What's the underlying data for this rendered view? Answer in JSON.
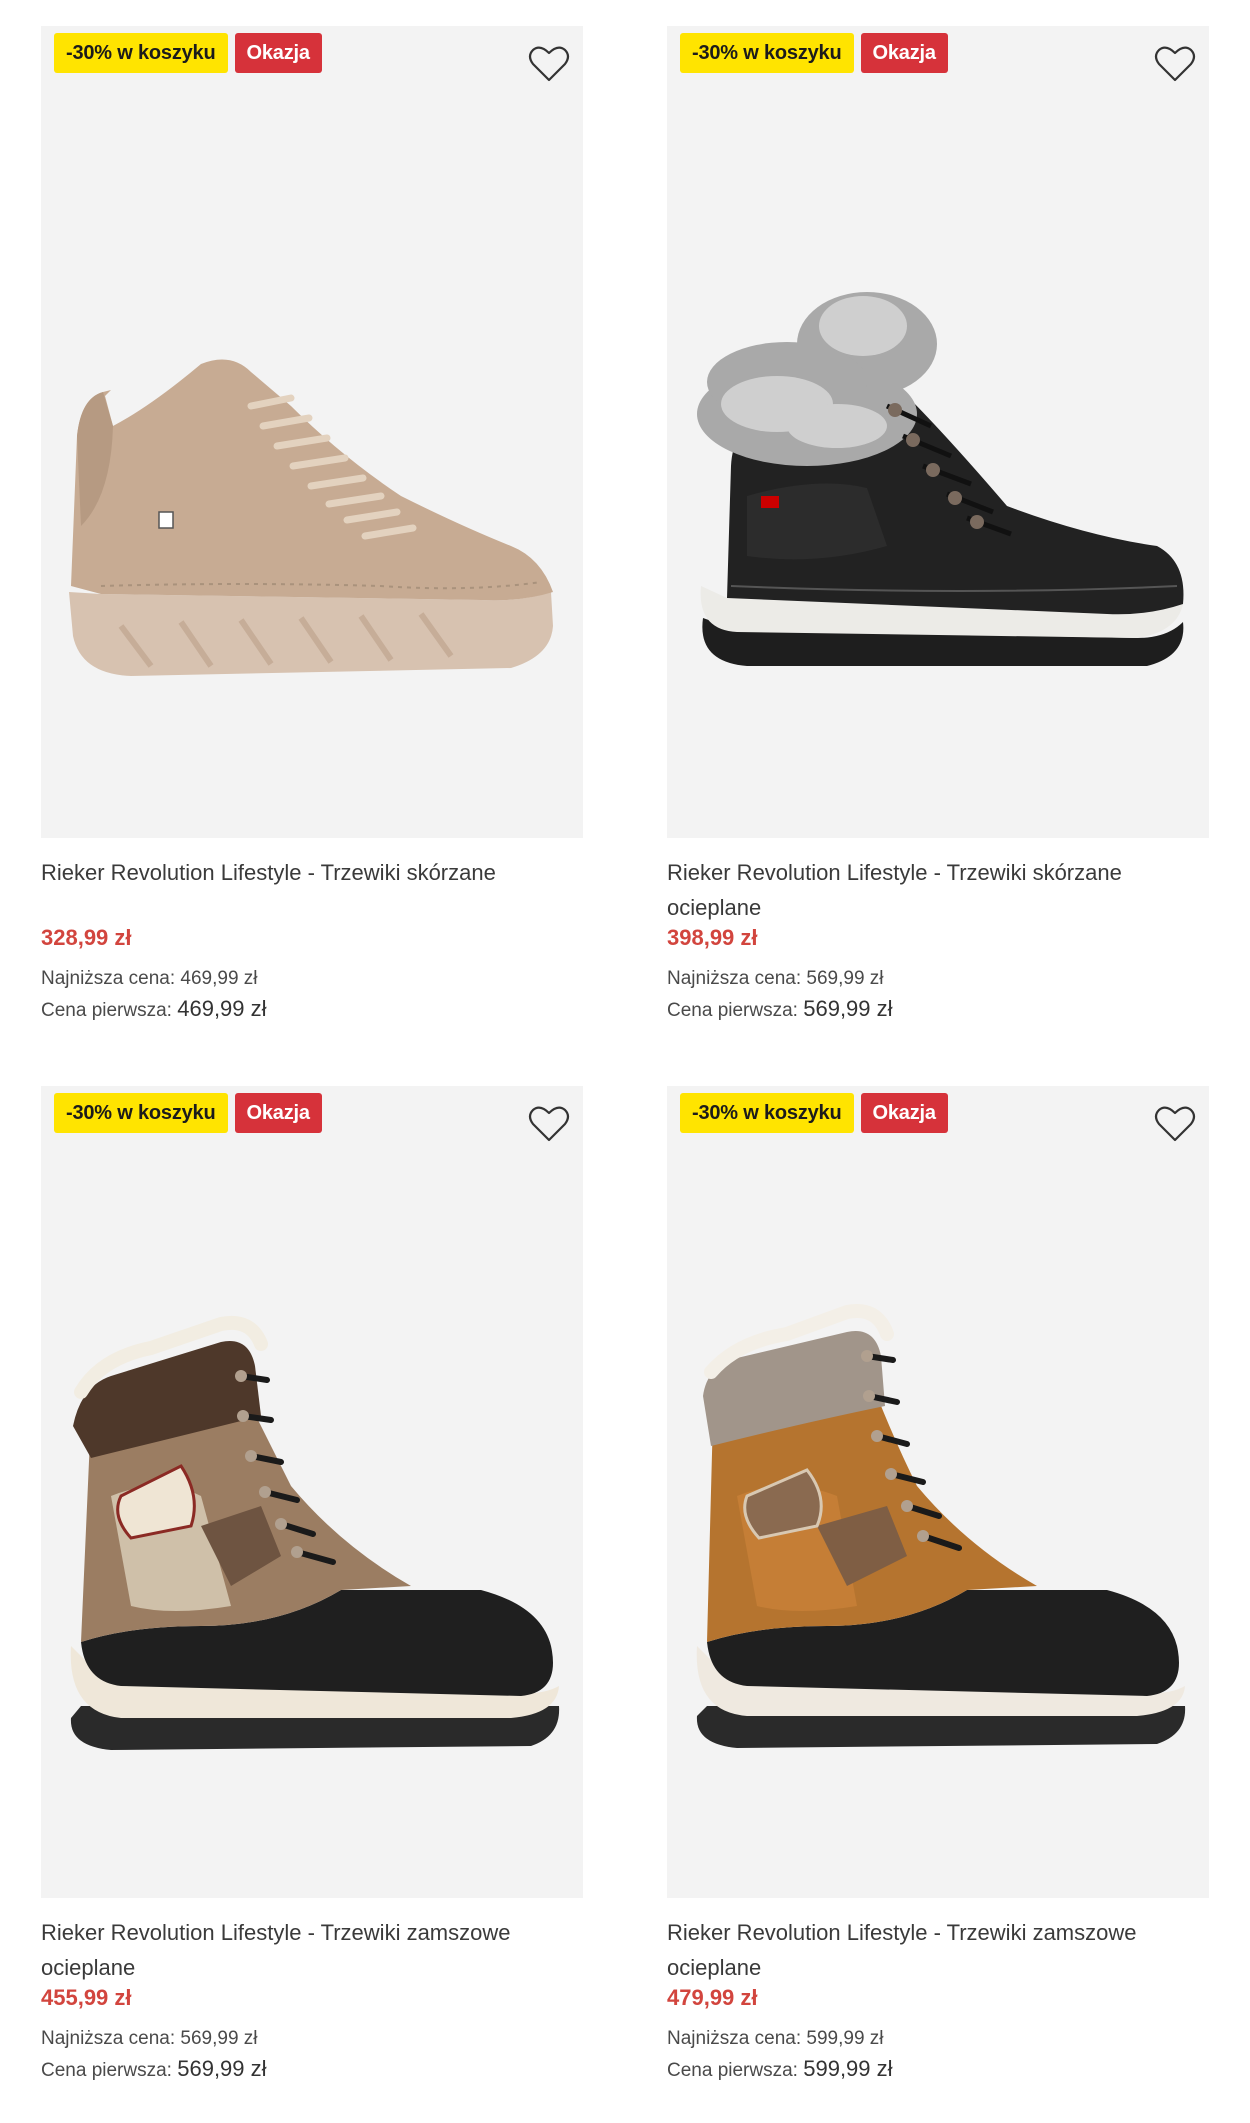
{
  "products": [
    {
      "badge_promo": "-30% w koszyku",
      "badge_deal": "Okazja",
      "title": "Rieker Revolution Lifestyle - Trzewiki skórzane",
      "price": "328,99 zł",
      "lowest_label": "Najniższa cena:",
      "lowest_value": "469,99 zł",
      "first_label": "Cena pierwsza:",
      "first_value": "469,99 zł",
      "image_icon": "beige-suede-sneaker-boot"
    },
    {
      "badge_promo": "-30% w koszyku",
      "badge_deal": "Okazja",
      "title": "Rieker Revolution Lifestyle - Trzewiki skórzane ocieplane",
      "price": "398,99 zł",
      "lowest_label": "Najniższa cena:",
      "lowest_value": "569,99 zł",
      "first_label": "Cena pierwsza:",
      "first_value": "569,99 zł",
      "image_icon": "black-leather-fur-boot"
    },
    {
      "badge_promo": "-30% w koszyku",
      "badge_deal": "Okazja",
      "title": "Rieker Revolution Lifestyle - Trzewiki zamszowe ocieplane",
      "price": "455,99 zł",
      "lowest_label": "Najniższa cena:",
      "lowest_value": "569,99 zł",
      "first_label": "Cena pierwsza:",
      "first_value": "569,99 zł",
      "image_icon": "taupe-suede-winter-boot"
    },
    {
      "badge_promo": "-30% w koszyku",
      "badge_deal": "Okazja",
      "title": "Rieker Revolution Lifestyle - Trzewiki zamszowe ocieplane",
      "price": "479,99 zł",
      "lowest_label": "Najniższa cena:",
      "lowest_value": "599,99 zł",
      "first_label": "Cena pierwsza:",
      "first_value": "599,99 zł",
      "image_icon": "cognac-suede-winter-boot"
    }
  ],
  "colors": {
    "promo_badge": "#ffe400",
    "deal_badge": "#d6323a",
    "price": "#d2453e",
    "image_bg": "#f3f3f3"
  }
}
